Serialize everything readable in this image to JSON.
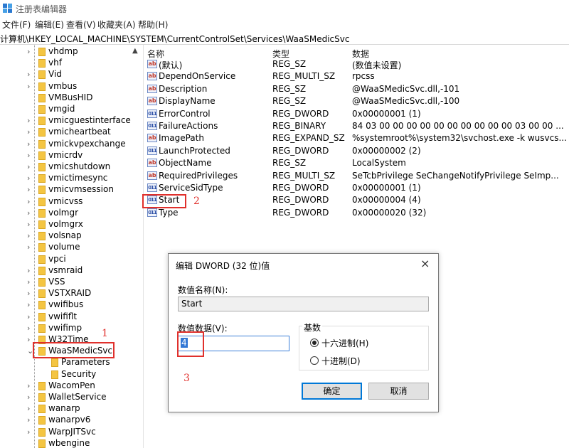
{
  "app": {
    "title": "注册表编辑器"
  },
  "menu": [
    "文件(F)",
    "编辑(E)",
    "查看(V)",
    "收藏夹(A)",
    "帮助(H)"
  ],
  "address": "计算机\\HKEY_LOCAL_MACHINE\\SYSTEM\\CurrentControlSet\\Services\\WaaSMedicSvc",
  "tree": {
    "items": [
      {
        "label": "vhdmp",
        "expandable": true
      },
      {
        "label": "vhf",
        "expandable": false
      },
      {
        "label": "Vid",
        "expandable": true
      },
      {
        "label": "vmbus",
        "expandable": true
      },
      {
        "label": "VMBusHID",
        "expandable": false
      },
      {
        "label": "vmgid",
        "expandable": false
      },
      {
        "label": "vmicguestinterface",
        "expandable": true
      },
      {
        "label": "vmicheartbeat",
        "expandable": true
      },
      {
        "label": "vmickvpexchange",
        "expandable": true
      },
      {
        "label": "vmicrdv",
        "expandable": true
      },
      {
        "label": "vmicshutdown",
        "expandable": true
      },
      {
        "label": "vmictimesync",
        "expandable": true
      },
      {
        "label": "vmicvmsession",
        "expandable": true
      },
      {
        "label": "vmicvss",
        "expandable": true
      },
      {
        "label": "volmgr",
        "expandable": true
      },
      {
        "label": "volmgrx",
        "expandable": true
      },
      {
        "label": "volsnap",
        "expandable": true
      },
      {
        "label": "volume",
        "expandable": true
      },
      {
        "label": "vpci",
        "expandable": false
      },
      {
        "label": "vsmraid",
        "expandable": true
      },
      {
        "label": "VSS",
        "expandable": true
      },
      {
        "label": "VSTXRAID",
        "expandable": true
      },
      {
        "label": "vwifibus",
        "expandable": true
      },
      {
        "label": "vwififlt",
        "expandable": true
      },
      {
        "label": "vwifimp",
        "expandable": true
      },
      {
        "label": "W32Time",
        "expandable": true
      },
      {
        "label": "WaaSMedicSvc",
        "expanded": true,
        "selected": true
      },
      {
        "label": "Parameters",
        "child": true
      },
      {
        "label": "Security",
        "child": true
      },
      {
        "label": "WacomPen",
        "expandable": true
      },
      {
        "label": "WalletService",
        "expandable": true
      },
      {
        "label": "wanarp",
        "expandable": true
      },
      {
        "label": "wanarpv6",
        "expandable": true
      },
      {
        "label": "WarpJITSvc",
        "expandable": true
      },
      {
        "label": "wbengine",
        "expandable": false
      }
    ]
  },
  "list": {
    "headers": {
      "name": "名称",
      "type": "类型",
      "data": "数据"
    },
    "rows": [
      {
        "icon": "string-value-icon",
        "name": "(默认)",
        "type": "REG_SZ",
        "data": "(数值未设置)"
      },
      {
        "icon": "string-value-icon",
        "name": "DependOnService",
        "type": "REG_MULTI_SZ",
        "data": "rpcss"
      },
      {
        "icon": "string-value-icon",
        "name": "Description",
        "type": "REG_SZ",
        "data": "@WaaSMedicSvc.dll,-101"
      },
      {
        "icon": "string-value-icon",
        "name": "DisplayName",
        "type": "REG_SZ",
        "data": "@WaaSMedicSvc.dll,-100"
      },
      {
        "icon": "binary-value-icon",
        "name": "ErrorControl",
        "type": "REG_DWORD",
        "data": "0x00000001 (1)"
      },
      {
        "icon": "binary-value-icon",
        "name": "FailureActions",
        "type": "REG_BINARY",
        "data": "84 03 00 00 00 00 00 00 00 00 00 00 03 00 00 ..."
      },
      {
        "icon": "string-value-icon",
        "name": "ImagePath",
        "type": "REG_EXPAND_SZ",
        "data": "%systemroot%\\system32\\svchost.exe -k wusvcs..."
      },
      {
        "icon": "binary-value-icon",
        "name": "LaunchProtected",
        "type": "REG_DWORD",
        "data": "0x00000002 (2)"
      },
      {
        "icon": "string-value-icon",
        "name": "ObjectName",
        "type": "REG_SZ",
        "data": "LocalSystem"
      },
      {
        "icon": "string-value-icon",
        "name": "RequiredPrivileges",
        "type": "REG_MULTI_SZ",
        "data": "SeTcbPrivilege SeChangeNotifyPrivilege SeImp..."
      },
      {
        "icon": "binary-value-icon",
        "name": "ServiceSidType",
        "type": "REG_DWORD",
        "data": "0x00000001 (1)"
      },
      {
        "icon": "binary-value-icon",
        "name": "Start",
        "type": "REG_DWORD",
        "data": "0x00000004 (4)"
      },
      {
        "icon": "binary-value-icon",
        "name": "Type",
        "type": "REG_DWORD",
        "data": "0x00000020 (32)"
      }
    ]
  },
  "annotations": {
    "one": "1",
    "two": "2",
    "three": "3"
  },
  "dialog": {
    "title": "编辑 DWORD (32 位)值",
    "close": "×",
    "name_label": "数值名称(N):",
    "name_value": "Start",
    "data_label": "数值数据(V):",
    "data_value": "4",
    "base_label": "基数",
    "hex_label": "十六进制(H)",
    "dec_label": "十进制(D)",
    "ok": "确定",
    "cancel": "取消"
  },
  "colors": {
    "annotation": "#e0302c",
    "selection": "#3277d4",
    "folder": "#f4c542"
  }
}
